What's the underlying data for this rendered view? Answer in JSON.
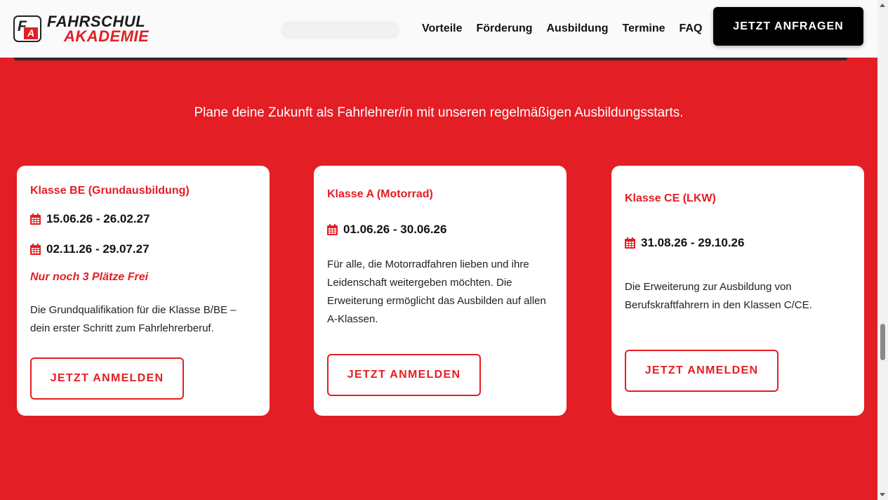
{
  "header": {
    "logo_top": "FAHRSCHUL",
    "logo_bottom": "AKADEMIE",
    "nav": [
      "Vorteile",
      "Förderung",
      "Ausbildung",
      "Termine",
      "FAQ"
    ],
    "cta": "JETZT ANFRAGEN"
  },
  "intro": "Plane deine Zukunft als Fahrlehrer/in mit unseren regelmäßigen Ausbildungsstarts.",
  "cards": [
    {
      "title": "Klasse BE (Grundausbildung)",
      "dates": [
        "15.06.26 - 26.02.27",
        "02.11.26 - 29.07.27"
      ],
      "note": "Nur noch 3 Plätze Frei",
      "desc": "Die Grundqualifikation für die Klasse B/BE – dein erster Schritt zum Fahrlehrerberuf.",
      "button": "JETZT ANMELDEN"
    },
    {
      "title": "Klasse A (Motorrad)",
      "dates": [
        "01.06.26 - 30.06.26"
      ],
      "desc": "Für alle, die Motorradfahren lieben und ihre Leidenschaft weitergeben möchten. Die Erweiterung ermöglicht das Ausbilden auf allen A-Klassen.",
      "button": "JETZT ANMELDEN"
    },
    {
      "title": "Klasse CE (LKW)",
      "dates": [
        "31.08.26 - 29.10.26"
      ],
      "desc": "Die Erweiterung zur Ausbildung von Berufskraftfahrern in den Klassen C/CE.",
      "button": "JETZT ANMELDEN"
    }
  ],
  "colors": {
    "brand_red": "#e31e24",
    "dark": "#000000",
    "card_bg": "#ffffff"
  },
  "icons": {
    "date": "calendar-icon"
  }
}
